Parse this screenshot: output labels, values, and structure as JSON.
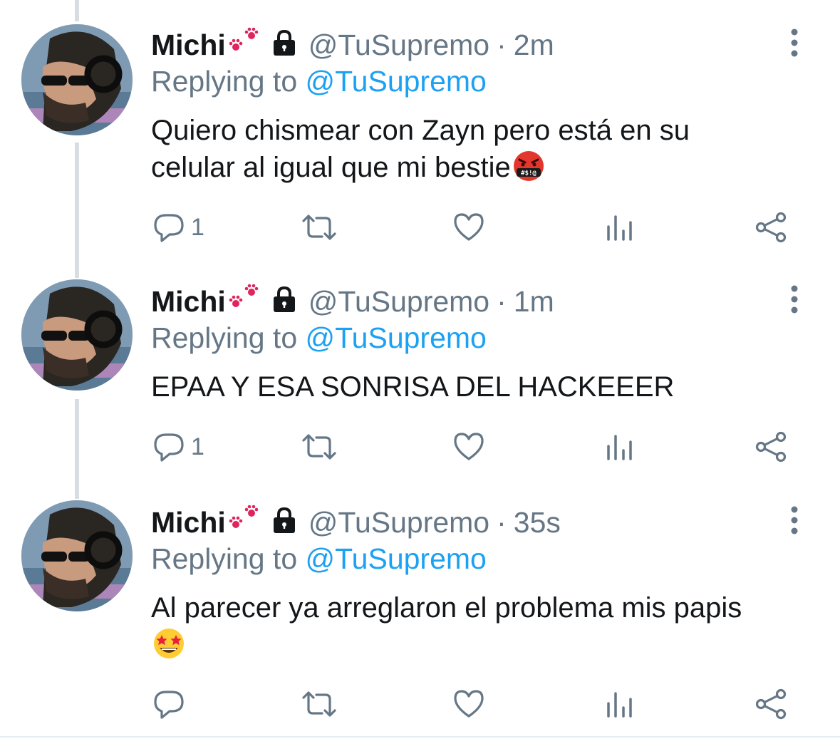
{
  "tweets": [
    {
      "author_name": "Michi",
      "handle": "@TuSupremo",
      "separator": "·",
      "time": "2m",
      "replying_prefix": "Replying to",
      "replying_handle": "@TuSupremo",
      "text_line1": "Quiero chismear con Zayn pero está en su",
      "text_line2": "celular al igual que mi bestie",
      "text_emoji": "cursing-face-emoji",
      "reply_count": "1",
      "retweet_count": "",
      "like_count": ""
    },
    {
      "author_name": "Michi",
      "handle": "@TuSupremo",
      "separator": "·",
      "time": "1m",
      "replying_prefix": "Replying to",
      "replying_handle": "@TuSupremo",
      "text_line1": "EPAA Y ESA SONRISA DEL HACKEEER",
      "reply_count": "1",
      "retweet_count": "",
      "like_count": ""
    },
    {
      "author_name": "Michi",
      "handle": "@TuSupremo",
      "separator": "·",
      "time": "35s",
      "replying_prefix": "Replying to",
      "replying_handle": "@TuSupremo",
      "text_line1": "Al parecer ya arreglaron el problema mis papis",
      "text_emoji": "star-struck-emoji",
      "reply_count": "",
      "retweet_count": "",
      "like_count": ""
    }
  ],
  "icons": {
    "paw": "paw-prints-icon",
    "lock": "lock-icon",
    "more": "more-vertical-icon",
    "reply": "reply-icon",
    "retweet": "retweet-icon",
    "like": "heart-icon",
    "analytics": "analytics-icon",
    "share": "share-icon"
  },
  "colors": {
    "text": "#14171a",
    "secondary": "#657786",
    "link": "#1da1f2",
    "thread_line": "#d8dde1",
    "paw": "#e0245e"
  }
}
